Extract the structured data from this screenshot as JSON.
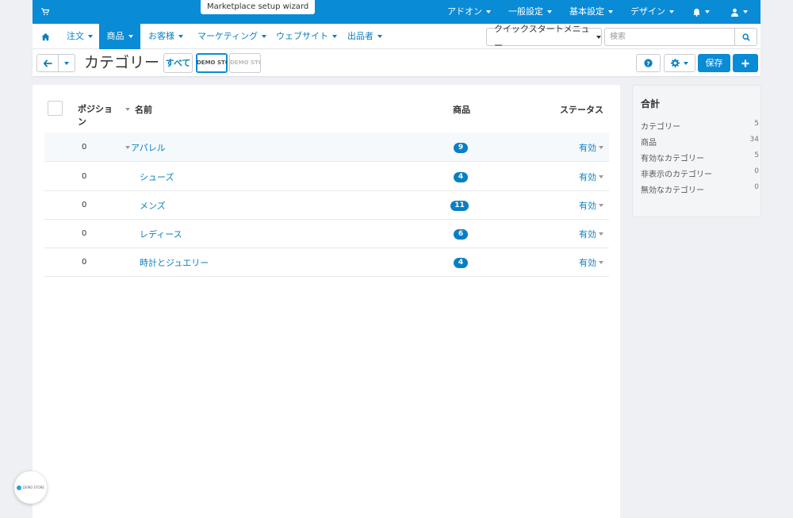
{
  "topbar": {
    "wizard_label": "Marketplace setup wizard",
    "menu": [
      {
        "label": "アドオン"
      },
      {
        "label": "一般設定"
      },
      {
        "label": "基本設定"
      },
      {
        "label": "デザイン"
      }
    ]
  },
  "nav": {
    "items": [
      {
        "label": "注文"
      },
      {
        "label": "商品"
      },
      {
        "label": "お客様"
      },
      {
        "label": "マーケティング"
      },
      {
        "label": "ウェブサイト"
      },
      {
        "label": "出品者"
      }
    ],
    "active_index": 1,
    "quickstart_label": "クイックスタートメニュー",
    "search_placeholder": "検索"
  },
  "titlebar": {
    "title": "カテゴリー",
    "storefront_all": "すべて",
    "storefront_logos": [
      "DEMO STORE",
      "DEMO STORE"
    ],
    "save_label": "保存"
  },
  "table": {
    "headers": {
      "position": "ポジション",
      "name": "名前",
      "products": "商品",
      "status": "ステータス"
    },
    "rows": [
      {
        "position": "0",
        "name": "アパレル",
        "products": "9",
        "status": "有効"
      },
      {
        "position": "0",
        "name": "シューズ",
        "products": "4",
        "status": "有効"
      },
      {
        "position": "0",
        "name": "メンズ",
        "products": "11",
        "status": "有効"
      },
      {
        "position": "0",
        "name": "レディース",
        "products": "6",
        "status": "有効"
      },
      {
        "position": "0",
        "name": "時計とジュエリー",
        "products": "4",
        "status": "有効"
      }
    ]
  },
  "summary": {
    "title": "合計",
    "rows": [
      {
        "label": "カテゴリー",
        "value": "5"
      },
      {
        "label": "商品",
        "value": "34"
      },
      {
        "label": "有効なカテゴリー",
        "value": "5"
      },
      {
        "label": "非表示のカテゴリー",
        "value": "0"
      },
      {
        "label": "無効なカテゴリー",
        "value": "0"
      }
    ]
  },
  "floater": {
    "label": "DEMO STORE"
  },
  "colors": {
    "accent": "#0a8bd6",
    "link": "#0a7fc2",
    "background": "#eef0f3"
  },
  "icons": [
    "cart-icon",
    "bell-icon",
    "user-icon",
    "home-icon",
    "search-icon",
    "arrow-left-icon",
    "help-icon",
    "gear-icon",
    "plus-icon"
  ]
}
